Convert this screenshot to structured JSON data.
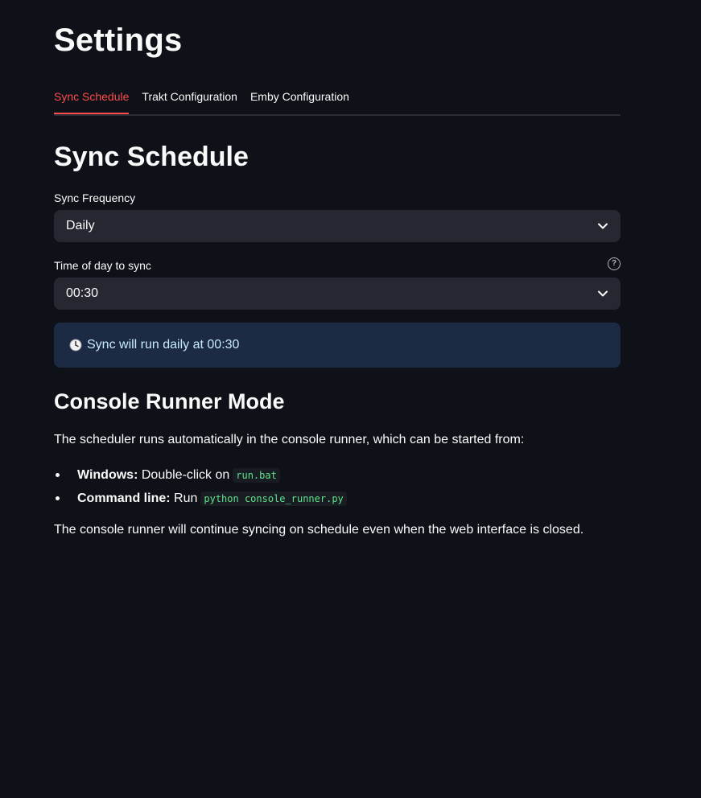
{
  "page": {
    "title": "Settings"
  },
  "tabs": [
    {
      "label": "Sync Schedule",
      "active": true
    },
    {
      "label": "Trakt Configuration",
      "active": false
    },
    {
      "label": "Emby Configuration",
      "active": false
    }
  ],
  "sync_schedule": {
    "heading": "Sync Schedule",
    "frequency": {
      "label": "Sync Frequency",
      "value": "Daily"
    },
    "time_of_day": {
      "label": "Time of day to sync",
      "value": "00:30",
      "help_icon": "question-circle-icon"
    },
    "info": {
      "icon": "clock-icon",
      "text": "Sync will run daily at 00:30"
    }
  },
  "console_runner": {
    "heading": "Console Runner Mode",
    "intro": "The scheduler runs automatically in the console runner, which can be started from:",
    "items": [
      {
        "bold": "Windows:",
        "text": "Double-click on",
        "code": "run.bat"
      },
      {
        "bold": "Command line:",
        "text": "Run",
        "code": "python console_runner.py"
      }
    ],
    "outro": "The console runner will continue syncing on schedule even when the web interface is closed."
  },
  "colors": {
    "background": "#0e1117",
    "accent": "#ff4b4b",
    "select_bg": "#262730",
    "info_bg": "#1c2a44",
    "info_text": "#c7ebff",
    "code_text": "#5ce488"
  }
}
